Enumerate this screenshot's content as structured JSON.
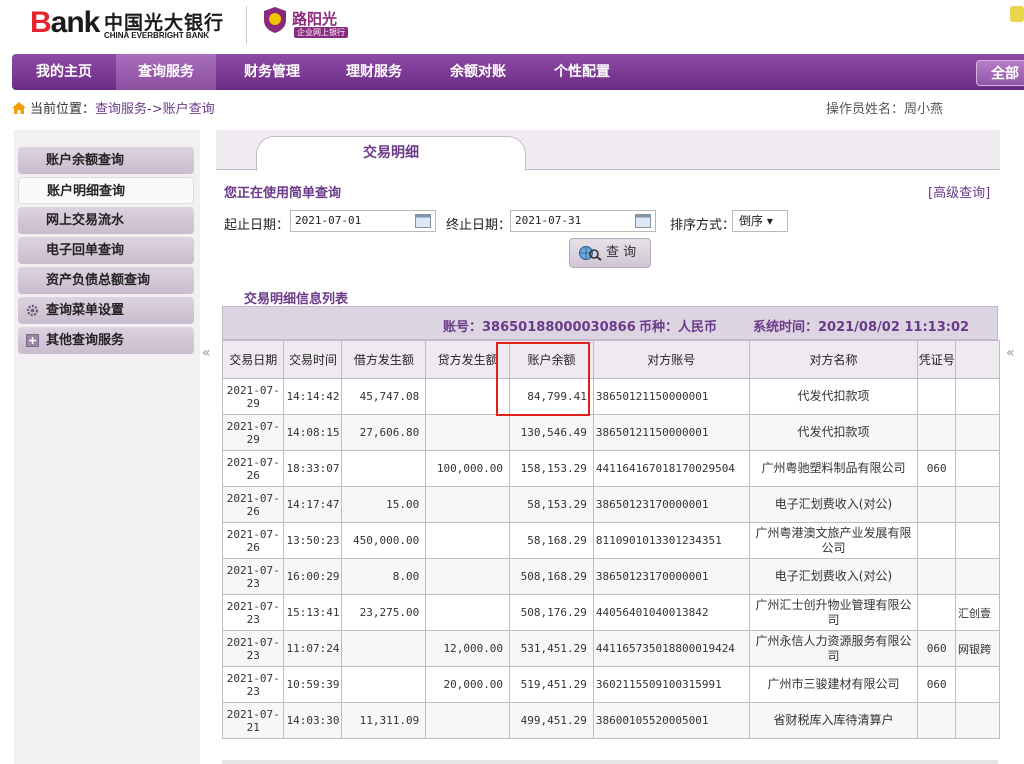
{
  "header": {
    "logo_bank": "ank",
    "logo_bank_b": "B",
    "logo_cn": "中国光大银行",
    "logo_en": "CHINA EVERBRIGHT BANK",
    "badge_title": "路阳光",
    "badge_sub": "企业网上银行"
  },
  "nav": {
    "items": [
      "我的主页",
      "查询服务",
      "财务管理",
      "理财服务",
      "余额对账",
      "个性配置"
    ],
    "active_index": 1,
    "all_label": "全部"
  },
  "breadcrumb": {
    "prefix": "当前位置：",
    "path": "查询服务->账户查询"
  },
  "operator": {
    "label": "操作员姓名：周小燕"
  },
  "sidebar": {
    "items": [
      {
        "label": "账户余额查询"
      },
      {
        "label": "账户明细查询",
        "active": true
      },
      {
        "label": "网上交易流水"
      },
      {
        "label": "电子回单查询"
      },
      {
        "label": "资产负债总额查询"
      },
      {
        "label": "查询菜单设置",
        "icon": "gear-icon"
      },
      {
        "label": "其他查询服务",
        "icon": "plus-box-icon"
      }
    ]
  },
  "main": {
    "tab_label": "交易明细",
    "simple_query_label": "您正在使用简单查询",
    "advanced_link": "[高级查询]",
    "form": {
      "start_label": "起止日期：",
      "start_value": "2021-07-01",
      "end_label": "终止日期：",
      "end_value": "2021-07-31",
      "sort_label": "排序方式：",
      "sort_value": "倒序"
    },
    "query_button": "查 询",
    "list_title": "交易明细信息列表",
    "info": {
      "account": "账号：38650188000030866",
      "currency": "币种：人民币",
      "system_time": "系统时间：2021/08/02 11:13:02"
    },
    "table": {
      "headers": [
        "交易日期",
        "交易时间",
        "借方发生额",
        "贷方发生额",
        "账户余额",
        "对方账号",
        "对方名称",
        "凭证号",
        ""
      ],
      "rows": [
        {
          "date1": "2021-07-",
          "date2": "29",
          "time": "14:14:42",
          "debit": "45,747.08",
          "credit": "",
          "balance": "84,799.41",
          "acct": "38650121150000001",
          "name": "代发代扣款项",
          "voucher": "",
          "extra": ""
        },
        {
          "date1": "2021-07-",
          "date2": "29",
          "time": "14:08:15",
          "debit": "27,606.80",
          "credit": "",
          "balance": "130,546.49",
          "acct": "38650121150000001",
          "name": "代发代扣款项",
          "voucher": "",
          "extra": ""
        },
        {
          "date1": "2021-07-",
          "date2": "26",
          "time": "18:33:07",
          "debit": "",
          "credit": "100,000.00",
          "balance": "158,153.29",
          "acct": "441164167018170029504",
          "name": "广州粤驰塑料制品有限公司",
          "voucher": "060",
          "extra": ""
        },
        {
          "date1": "2021-07-",
          "date2": "26",
          "time": "14:17:47",
          "debit": "15.00",
          "credit": "",
          "balance": "58,153.29",
          "acct": "38650123170000001",
          "name": "电子汇划费收入(对公)",
          "voucher": "",
          "extra": ""
        },
        {
          "date1": "2021-07-",
          "date2": "26",
          "time": "13:50:23",
          "debit": "450,000.00",
          "credit": "",
          "balance": "58,168.29",
          "acct": "8110901013301234351",
          "name": "广州粤港澳文旅产业发展有限公司",
          "voucher": "",
          "extra": ""
        },
        {
          "date1": "2021-07-",
          "date2": "23",
          "time": "16:00:29",
          "debit": "8.00",
          "credit": "",
          "balance": "508,168.29",
          "acct": "38650123170000001",
          "name": "电子汇划费收入(对公)",
          "voucher": "",
          "extra": ""
        },
        {
          "date1": "2021-07-",
          "date2": "23",
          "time": "15:13:41",
          "debit": "23,275.00",
          "credit": "",
          "balance": "508,176.29",
          "acct": "44056401040013842",
          "name": "广州汇士创升物业管理有限公司",
          "voucher": "",
          "extra": "汇创壹"
        },
        {
          "date1": "2021-07-",
          "date2": "23",
          "time": "11:07:24",
          "debit": "",
          "credit": "12,000.00",
          "balance": "531,451.29",
          "acct": "441165735018800019424",
          "name": "广州永信人力资源服务有限公司",
          "voucher": "060",
          "extra": "网银跨"
        },
        {
          "date1": "2021-07-",
          "date2": "23",
          "time": "10:59:39",
          "debit": "",
          "credit": "20,000.00",
          "balance": "519,451.29",
          "acct": "3602115509100315991",
          "name": "广州市三骏建材有限公司",
          "voucher": "060",
          "extra": ""
        },
        {
          "date1": "2021-07-",
          "date2": "21",
          "time": "14:03:30",
          "debit": "11,311.09",
          "credit": "",
          "balance": "499,451.29",
          "acct": "38600105520005001",
          "name": "省财税库入库待清算户",
          "voucher": "",
          "extra": ""
        }
      ]
    }
  },
  "colors": {
    "brand_purple": "#6b2c84",
    "accent_text": "#6b3a8a",
    "highlight_red": "#e0201a",
    "logo_red": "#e8222a"
  }
}
